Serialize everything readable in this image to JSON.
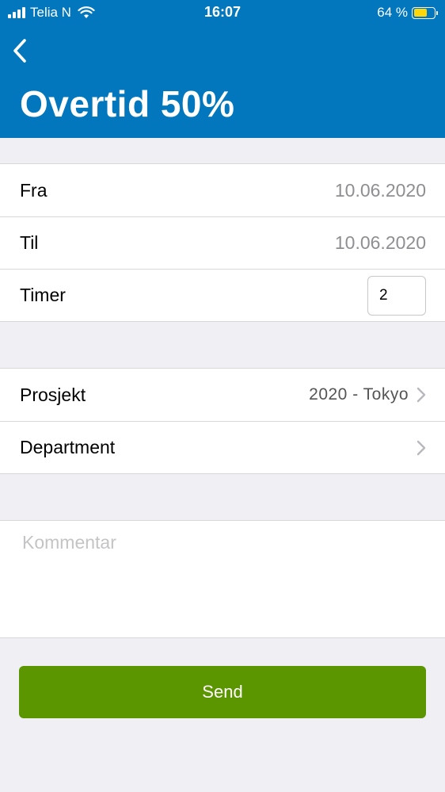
{
  "status_bar": {
    "carrier": "Telia N",
    "time": "16:07",
    "battery_text": "64 %",
    "battery_level": 0.64,
    "battery_color": "#ffd60a"
  },
  "header": {
    "title": "Overtid 50%",
    "back_icon": "chevron-left-icon",
    "background": "#0277bd"
  },
  "dates": {
    "from_label": "Fra",
    "from_value": "10.06.2020",
    "to_label": "Til",
    "to_value": "10.06.2020",
    "hours_label": "Timer",
    "hours_value": "2"
  },
  "assignment": {
    "project_label": "Prosjekt",
    "project_value": "2020 - Tokyo",
    "department_label": "Department",
    "department_value": ""
  },
  "comment": {
    "placeholder": "Kommentar",
    "value": ""
  },
  "send": {
    "label": "Send",
    "color": "#5b9500"
  }
}
